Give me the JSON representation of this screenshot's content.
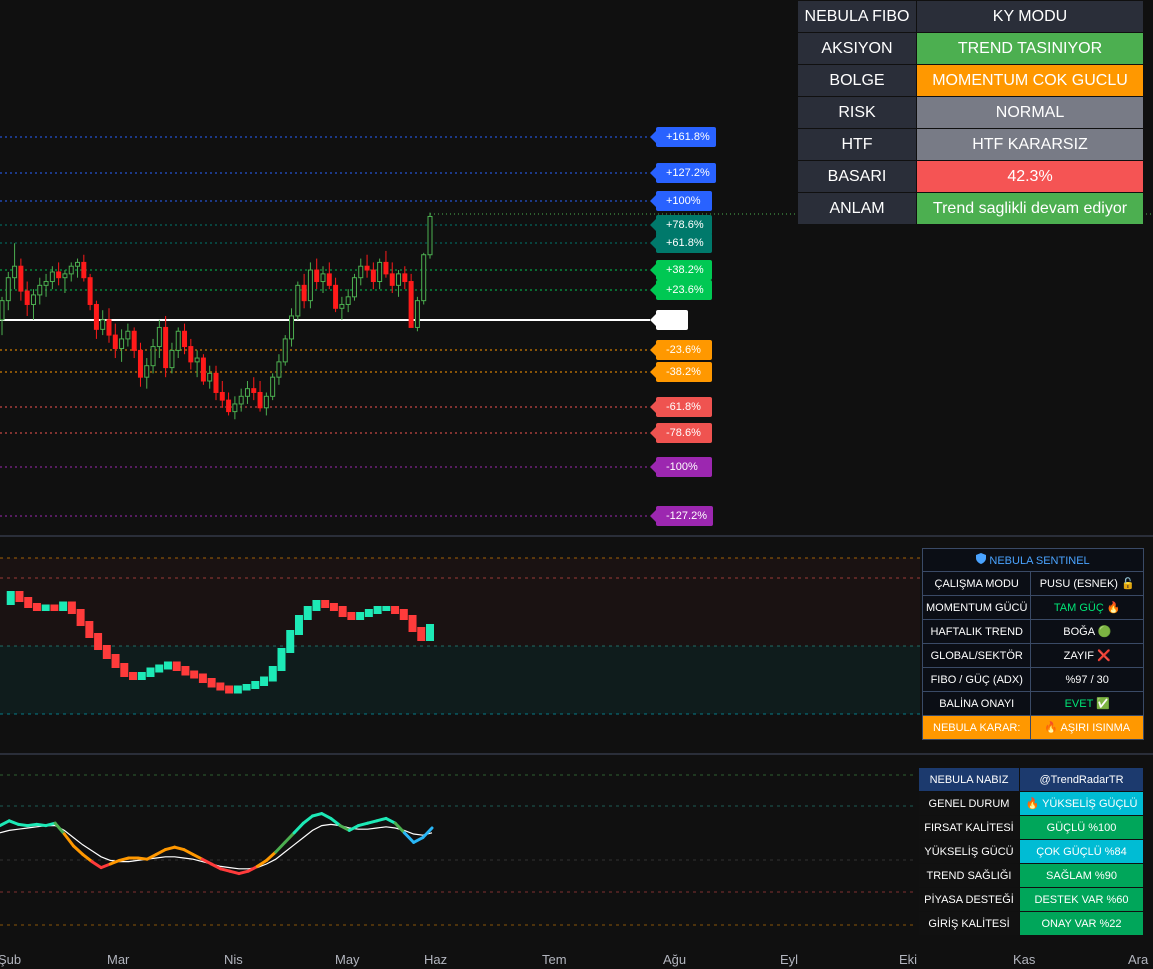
{
  "colors": {
    "background": "#101010",
    "bull": "#26a69a",
    "bear": "#ef5350",
    "bull_bright": "#4caf50",
    "bear_bright": "#ff1a1a",
    "teal": "#00e0a8",
    "orange": "#ff9800",
    "purple": "#9c27b0",
    "blue": "#2962ff",
    "green_label": "#00c853"
  },
  "fibo_levels": [
    {
      "label": "+161.8%",
      "color": "#2962ff"
    },
    {
      "label": "+127.2%",
      "color": "#2962ff"
    },
    {
      "label": "+100%",
      "color": "#2962ff"
    },
    {
      "label": "+78.6%",
      "color": "#00796b"
    },
    {
      "label": "+61.8%",
      "color": "#00796b"
    },
    {
      "label": "+38.2%",
      "color": "#00c853"
    },
    {
      "label": "+23.6%",
      "color": "#00c853"
    },
    {
      "label": "",
      "color": "#ffffff"
    },
    {
      "label": "-23.6%",
      "color": "#ff9800"
    },
    {
      "label": "-38.2%",
      "color": "#ff9800"
    },
    {
      "label": "-61.8%",
      "color": "#ef5350"
    },
    {
      "label": "-78.6%",
      "color": "#ef5350"
    },
    {
      "label": "-100%",
      "color": "#9c27b0"
    },
    {
      "label": "-127.2%",
      "color": "#9c27b0"
    }
  ],
  "fibo_table": {
    "title": "NEBULA FIBO",
    "mode": "KY MODU",
    "rows": [
      {
        "label": "AKSIYON",
        "value": "TREND TASINIYOR",
        "color": "#4caf50"
      },
      {
        "label": "BOLGE",
        "value": "MOMENTUM COK GUCLU",
        "color": "#ff9800"
      },
      {
        "label": "RISK",
        "value": "NORMAL",
        "color": "#787b86"
      },
      {
        "label": "HTF",
        "value": "HTF KARARSIZ",
        "color": "#787b86"
      },
      {
        "label": "BASARI",
        "value": "42.3%",
        "color": "#f55454"
      },
      {
        "label": "ANLAM",
        "value": "Trend saglikli devam ediyor",
        "color": "#4caf50"
      }
    ]
  },
  "sentinel": {
    "icon": "shield-icon",
    "title": "NEBULA SENTINEL",
    "rows": [
      {
        "label": "ÇALIŞMA MODU",
        "value": "PUSU (ESNEK) 🔓",
        "color": "#ffffff"
      },
      {
        "label": "MOMENTUM GÜCÜ",
        "value": "TAM GÜÇ 🔥",
        "color": "#00e676"
      },
      {
        "label": "HAFTALIK TREND",
        "value": "BOĞA 🟢",
        "color": "#ffffff"
      },
      {
        "label": "GLOBAL/SEKTÖR",
        "value": "ZAYIF ❌",
        "color": "#ffffff"
      },
      {
        "label": "FIBO / GÜÇ (ADX)",
        "value": "%97 / 30",
        "color": "#ffffff"
      },
      {
        "label": "BALİNA ONAYI",
        "value": "EVET ✅",
        "color": "#00e676"
      }
    ],
    "decision_label": "NEBULA KARAR:",
    "decision_value": "🔥 AŞIRI ISINMA"
  },
  "nabiz": {
    "title": "NEBULA NABIZ",
    "handle": "@TrendRadarTR",
    "rows": [
      {
        "label": "GENEL DURUM",
        "value": "🔥 YÜKSELİŞ GÜÇLÜ",
        "color": "#00bcd4"
      },
      {
        "label": "FIRSAT KALİTESİ",
        "value": "GÜÇLÜ %100",
        "color": "#00a65a"
      },
      {
        "label": "YÜKSELİŞ GÜCÜ",
        "value": "ÇOK GÜÇLÜ %84",
        "color": "#00bcd4"
      },
      {
        "label": "TREND SAĞLIĞI",
        "value": "SAĞLAM %90",
        "color": "#00a65a"
      },
      {
        "label": "PİYASA DESTEĞİ",
        "value": "DESTEK VAR %60",
        "color": "#00a65a"
      },
      {
        "label": "GİRİŞ KALİTESİ",
        "value": "ONAY VAR %22",
        "color": "#00a65a"
      }
    ]
  },
  "x_axis": {
    "labels": [
      "Şub",
      "Mar",
      "Nis",
      "May",
      "Haz",
      "Tem",
      "Ağu",
      "Eyl",
      "Eki",
      "Kas",
      "Ara"
    ]
  },
  "chart_data": {
    "type": "candlestick",
    "candles": [
      [
        1.5,
        1.62,
        1.42,
        1.6
      ],
      [
        1.6,
        1.75,
        1.55,
        1.72
      ],
      [
        1.72,
        1.9,
        1.66,
        1.78
      ],
      [
        1.78,
        1.82,
        1.6,
        1.65
      ],
      [
        1.65,
        1.7,
        1.52,
        1.58
      ],
      [
        1.58,
        1.66,
        1.5,
        1.63
      ],
      [
        1.63,
        1.72,
        1.58,
        1.68
      ],
      [
        1.68,
        1.74,
        1.62,
        1.7
      ],
      [
        1.7,
        1.78,
        1.66,
        1.75
      ],
      [
        1.75,
        1.8,
        1.68,
        1.72
      ],
      [
        1.72,
        1.76,
        1.64,
        1.74
      ],
      [
        1.74,
        1.8,
        1.7,
        1.78
      ],
      [
        1.78,
        1.82,
        1.72,
        1.8
      ],
      [
        1.8,
        1.84,
        1.7,
        1.72
      ],
      [
        1.72,
        1.74,
        1.55,
        1.58
      ],
      [
        1.58,
        1.6,
        1.4,
        1.45
      ],
      [
        1.45,
        1.55,
        1.42,
        1.5
      ],
      [
        1.5,
        1.56,
        1.38,
        1.42
      ],
      [
        1.42,
        1.48,
        1.3,
        1.35
      ],
      [
        1.35,
        1.45,
        1.28,
        1.4
      ],
      [
        1.4,
        1.48,
        1.36,
        1.44
      ],
      [
        1.44,
        1.46,
        1.3,
        1.34
      ],
      [
        1.34,
        1.38,
        1.15,
        1.2
      ],
      [
        1.2,
        1.3,
        1.14,
        1.26
      ],
      [
        1.26,
        1.4,
        1.22,
        1.36
      ],
      [
        1.36,
        1.5,
        1.3,
        1.46
      ],
      [
        1.46,
        1.52,
        1.2,
        1.25
      ],
      [
        1.25,
        1.38,
        1.22,
        1.34
      ],
      [
        1.34,
        1.46,
        1.3,
        1.44
      ],
      [
        1.44,
        1.48,
        1.32,
        1.36
      ],
      [
        1.36,
        1.4,
        1.24,
        1.28
      ],
      [
        1.28,
        1.34,
        1.2,
        1.3
      ],
      [
        1.3,
        1.32,
        1.16,
        1.18
      ],
      [
        1.18,
        1.26,
        1.14,
        1.22
      ],
      [
        1.22,
        1.26,
        1.08,
        1.12
      ],
      [
        1.12,
        1.18,
        1.04,
        1.08
      ],
      [
        1.08,
        1.12,
        1.0,
        1.02
      ],
      [
        1.02,
        1.1,
        0.98,
        1.06
      ],
      [
        1.06,
        1.14,
        1.02,
        1.1
      ],
      [
        1.1,
        1.18,
        1.06,
        1.14
      ],
      [
        1.14,
        1.2,
        1.08,
        1.12
      ],
      [
        1.12,
        1.18,
        1.02,
        1.04
      ],
      [
        1.04,
        1.12,
        1.0,
        1.1
      ],
      [
        1.1,
        1.22,
        1.08,
        1.2
      ],
      [
        1.2,
        1.32,
        1.16,
        1.28
      ],
      [
        1.28,
        1.42,
        1.26,
        1.4
      ],
      [
        1.4,
        1.56,
        1.36,
        1.52
      ],
      [
        1.52,
        1.7,
        1.5,
        1.68
      ],
      [
        1.68,
        1.74,
        1.56,
        1.6
      ],
      [
        1.6,
        1.8,
        1.56,
        1.76
      ],
      [
        1.76,
        1.82,
        1.66,
        1.7
      ],
      [
        1.7,
        1.78,
        1.64,
        1.74
      ],
      [
        1.74,
        1.8,
        1.66,
        1.68
      ],
      [
        1.68,
        1.72,
        1.54,
        1.56
      ],
      [
        1.56,
        1.62,
        1.5,
        1.58
      ],
      [
        1.58,
        1.66,
        1.54,
        1.62
      ],
      [
        1.62,
        1.74,
        1.6,
        1.72
      ],
      [
        1.72,
        1.82,
        1.68,
        1.78
      ],
      [
        1.78,
        1.84,
        1.72,
        1.76
      ],
      [
        1.76,
        1.8,
        1.66,
        1.7
      ],
      [
        1.7,
        1.82,
        1.66,
        1.8
      ],
      [
        1.8,
        1.86,
        1.72,
        1.74
      ],
      [
        1.74,
        1.8,
        1.64,
        1.68
      ],
      [
        1.68,
        1.76,
        1.62,
        1.74
      ],
      [
        1.74,
        1.78,
        1.66,
        1.7
      ],
      [
        1.7,
        1.74,
        1.56,
        1.46
      ],
      [
        1.46,
        1.62,
        1.44,
        1.6
      ],
      [
        1.6,
        1.85,
        1.58,
        1.84
      ],
      [
        1.84,
        2.06,
        1.82,
        2.04
      ]
    ],
    "fibo_ratios": [
      1.618,
      1.272,
      1.0,
      0.786,
      0.618,
      0.382,
      0.236,
      0,
      -0.236,
      -0.382,
      -0.618,
      -0.786,
      -1.0,
      -1.272
    ],
    "sentinel_osc": [
      0.72,
      0.78,
      0.74,
      0.7,
      0.68,
      0.69,
      0.68,
      0.71,
      0.66,
      0.58,
      0.5,
      0.42,
      0.36,
      0.3,
      0.24,
      0.22,
      0.24,
      0.27,
      0.29,
      0.31,
      0.28,
      0.25,
      0.23,
      0.2,
      0.17,
      0.15,
      0.13,
      0.15,
      0.16,
      0.18,
      0.21,
      0.28,
      0.4,
      0.52,
      0.62,
      0.68,
      0.72,
      0.7,
      0.68,
      0.64,
      0.62,
      0.64,
      0.66,
      0.68,
      0.68,
      0.66,
      0.62,
      0.54,
      0.48,
      0.56
    ],
    "nabiz_fast": [
      0.62,
      0.66,
      0.63,
      0.62,
      0.63,
      0.62,
      0.64,
      0.55,
      0.45,
      0.38,
      0.32,
      0.27,
      0.3,
      0.33,
      0.35,
      0.35,
      0.34,
      0.38,
      0.42,
      0.44,
      0.42,
      0.38,
      0.34,
      0.3,
      0.26,
      0.24,
      0.22,
      0.24,
      0.28,
      0.33,
      0.4,
      0.48,
      0.56,
      0.64,
      0.7,
      0.72,
      0.68,
      0.62,
      0.58,
      0.62,
      0.64,
      0.66,
      0.68,
      0.64,
      0.56,
      0.48,
      0.52,
      0.6
    ],
    "nabiz_slow": [
      0.56,
      0.58,
      0.59,
      0.6,
      0.61,
      0.62,
      0.62,
      0.58,
      0.52,
      0.46,
      0.41,
      0.36,
      0.33,
      0.32,
      0.32,
      0.33,
      0.34,
      0.35,
      0.36,
      0.36,
      0.35,
      0.34,
      0.32,
      0.3,
      0.28,
      0.27,
      0.26,
      0.26,
      0.27,
      0.3,
      0.34,
      0.4,
      0.46,
      0.52,
      0.58,
      0.62,
      0.63,
      0.62,
      0.6,
      0.59,
      0.59,
      0.6,
      0.61,
      0.6,
      0.58,
      0.55,
      0.54,
      0.56
    ]
  }
}
